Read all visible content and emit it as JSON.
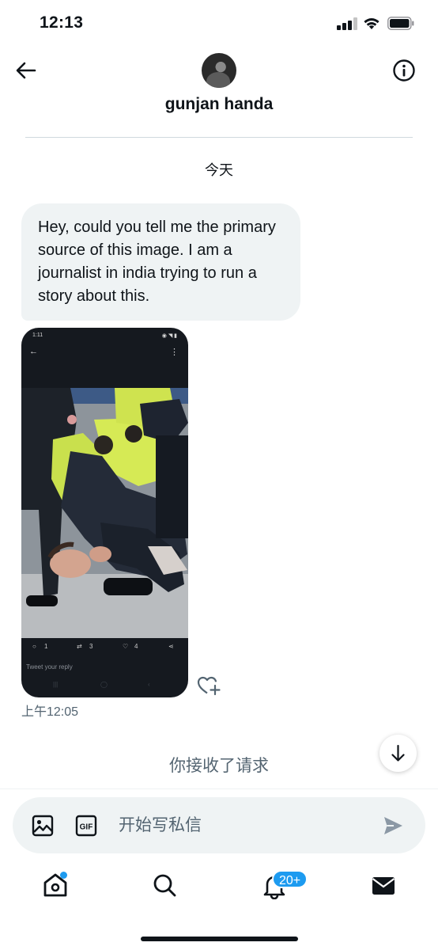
{
  "status_bar": {
    "time": "12:13"
  },
  "header": {
    "contact_name": "gunjan handa"
  },
  "conversation": {
    "date_separator": "今天",
    "message": {
      "text": "Hey, could you tell me the primary source of this image. I am a journalist in india trying to run a story about this.",
      "time": "上午12:05"
    },
    "attachment": {
      "phone_time": "1:11",
      "reply_count": "1",
      "retweet_count": "3",
      "like_count": "4",
      "reply_placeholder": "Tweet your reply"
    },
    "accepted_notice": "你接收了请求"
  },
  "composer": {
    "placeholder": "开始写私信",
    "gif_label": "GIF"
  },
  "tabbar": {
    "notifications_badge": "20+"
  },
  "colors": {
    "accent": "#1d9bf0",
    "bubble": "#eff3f4",
    "secondary_text": "#536471"
  }
}
